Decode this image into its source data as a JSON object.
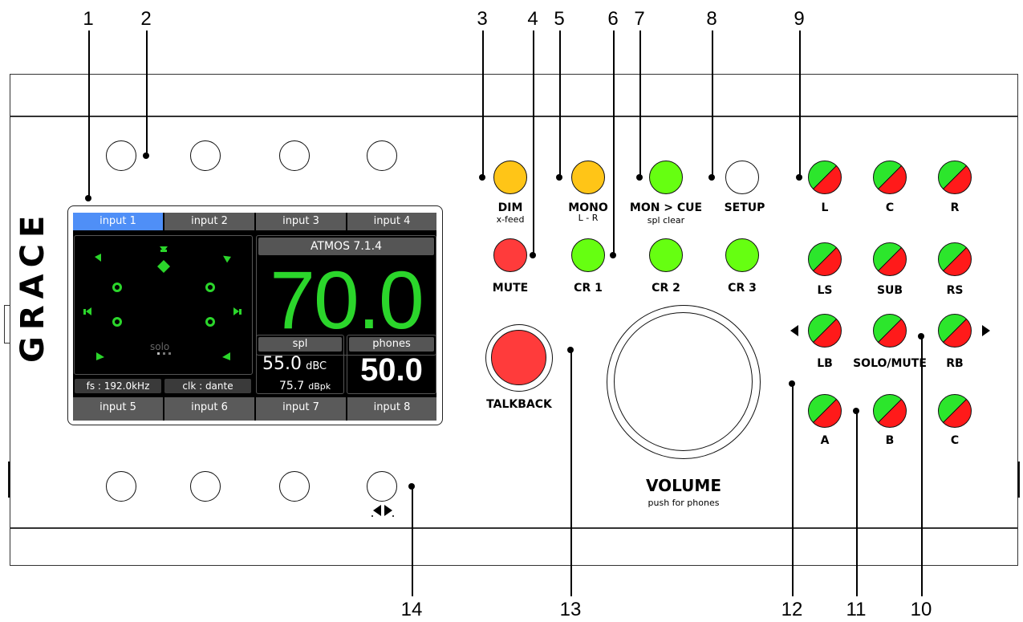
{
  "callouts": [
    "1",
    "2",
    "3",
    "4",
    "5",
    "6",
    "7",
    "8",
    "9",
    "10",
    "11",
    "12",
    "13",
    "14"
  ],
  "brand": "GRACE",
  "screen": {
    "top_tabs": [
      "input 1",
      "input 2",
      "input 3",
      "input 4"
    ],
    "bottom_tabs": [
      "input 5",
      "input 6",
      "input 7",
      "input 8"
    ],
    "format": "ATMOS 7.1.4",
    "main_level": "70.0",
    "solo": "solo",
    "fs": "fs : 192.0kHz",
    "clk": "clk : dante",
    "spl_label": "spl",
    "spl_value": "55.0",
    "spl_unit": "dBC",
    "spl_peak": "75.7",
    "spl_peak_unit": "dBpk",
    "phones_label": "phones",
    "phones_value": "50.0"
  },
  "buttons": {
    "dim": "DIM",
    "dim_sub": "x-feed",
    "mono": "MONO",
    "mono_sub": "L - R",
    "mon_cue": "MON > CUE",
    "mon_cue_sub": "spl clear",
    "setup": "SETUP",
    "mute": "MUTE",
    "cr1": "CR 1",
    "cr2": "CR 2",
    "cr3": "CR 3",
    "talkback": "TALKBACK",
    "volume": "VOLUME",
    "volume_sub": "push for phones",
    "l": "L",
    "c": "C",
    "r": "R",
    "ls": "LS",
    "sub": "SUB",
    "rs": "RS",
    "lb": "LB",
    "solo_mute": "SOLO/MUTE",
    "rb": "RB",
    "a": "A",
    "b": "B",
    "c2": "C"
  },
  "colors": {
    "yellow": "#ffc517",
    "green": "#66ff11",
    "red": "#ff3b3b",
    "screen_green": "#2bd62b",
    "tab_active": "#4f8ff7"
  }
}
